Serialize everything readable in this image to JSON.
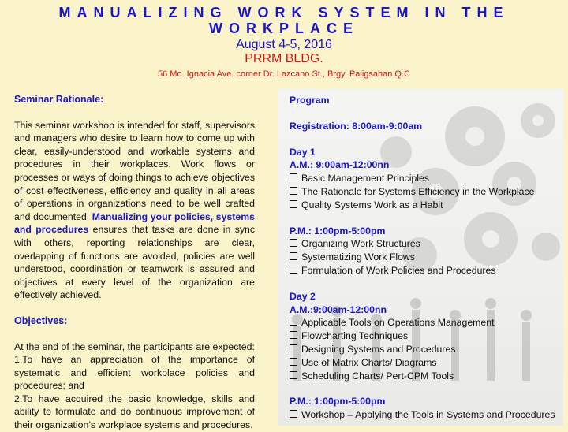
{
  "header": {
    "title_line1": "MANUALIZING WORK SYSTEM IN THE",
    "title_line2": "WORKPLACE",
    "date": "August 4-5, 2016",
    "venue": "PRRM BLDG.",
    "address": "56 Mo. Ignacia Ave. corner Dr. Lazcano St., Brgy. Paligsahan Q.C"
  },
  "rationale": {
    "heading": "Seminar Rationale:",
    "text_before": "This seminar workshop is intended for staff, supervisors and managers who desire to learn how to come up with clear, easily-understood and workable systems and procedures in their workplaces. Work flows or processes or ways of doing things to achieve objectives of cost effectiveness, efficiency and quality in all areas of operations in organizations need to be well crafted and documented.",
    "highlight": "Manualizing  your policies, systems and procedures",
    "text_after": "ensures that tasks are done in sync with others, reporting relationships are clear, overlapping of functions are avoided, policies are well understood, coordination or teamwork is assured and objectives at every level of the organization are effectively achieved."
  },
  "objectives": {
    "heading": "Objectives:",
    "intro": "At the end of the seminar, the participants  are expected:",
    "item1": "1.To have an appreciation of the importance   of systematic and efficient workplace policies and procedures; and",
    "item2": "2.To have acquired the basic knowledge, skills and ability to formulate and do continuous improvement of their organization’s workplace systems and procedures."
  },
  "program": {
    "heading": "Program",
    "registration": "Registration: 8:00am-9:00am",
    "day1": {
      "label": "Day  1",
      "am": "A.M.: 9:00am-12:00nn",
      "am_items": [
        "Basic Management Principles",
        " The Rationale for Systems Efficiency in the   Workplace",
        " Quality Systems Work as a Habit"
      ],
      "pm": "P.M.:  1:00pm-5:00pm",
      "pm_items": [
        " Organizing  Work  Structures",
        " Systematizing Work Flows",
        "Formulation   of   Work   Policies   and Procedures"
      ]
    },
    "day2": {
      "label": "Day  2",
      "am": "A.M.:9:00am-12:00nn",
      "am_items": [
        "Applicable Tools on Operations Management",
        " Flowcharting Techniques",
        " Designing Systems and Procedures",
        " Use of Matrix Charts/ Diagrams",
        "Scheduling Charts/ Pert-CPM Tools"
      ],
      "pm": "P.M.: 1:00pm-5:00pm",
      "pm_items": [
        "Workshop – Applying the Tools in Systems and Procedures"
      ]
    }
  }
}
